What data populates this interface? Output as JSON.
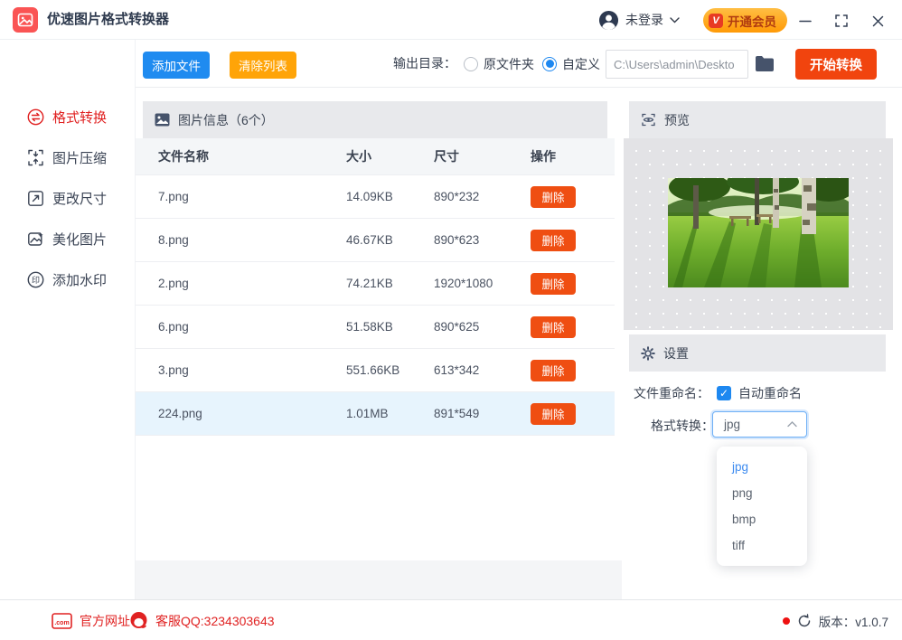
{
  "titlebar": {
    "app_title": "优速图片格式转换器",
    "login_label": "未登录",
    "vip_badge": "V",
    "vip_label": "开通会员"
  },
  "sidebar": {
    "items": [
      {
        "label": "格式转换",
        "icon": "format-convert-icon",
        "active": true
      },
      {
        "label": "图片压缩",
        "icon": "compress-icon",
        "active": false
      },
      {
        "label": "更改尺寸",
        "icon": "resize-icon",
        "active": false
      },
      {
        "label": "美化图片",
        "icon": "beautify-icon",
        "active": false
      },
      {
        "label": "添加水印",
        "icon": "watermark-icon",
        "active": false
      }
    ]
  },
  "toolbar": {
    "add_files": "添加文件",
    "clear_list": "清除列表",
    "output_dir_label": "输出目录：",
    "radio_original": "原文件夹",
    "radio_custom": "自定义",
    "radio_selected": "自定义",
    "path_value": "C:\\Users\\admin\\Deskto",
    "start_button": "开始转换"
  },
  "table": {
    "section_title": "图片信息（6个）",
    "columns": [
      "文件名称",
      "大小",
      "尺寸",
      "操作"
    ],
    "delete_label": "删除",
    "rows": [
      {
        "name": "7.png",
        "size": "14.09KB",
        "dims": "890*232",
        "selected": false
      },
      {
        "name": "8.png",
        "size": "46.67KB",
        "dims": "890*623",
        "selected": false
      },
      {
        "name": "2.png",
        "size": "74.21KB",
        "dims": "1920*1080",
        "selected": false
      },
      {
        "name": "6.png",
        "size": "51.58KB",
        "dims": "890*625",
        "selected": false
      },
      {
        "name": "3.png",
        "size": "551.66KB",
        "dims": "613*342",
        "selected": false
      },
      {
        "name": "224.png",
        "size": "1.01MB",
        "dims": "891*549",
        "selected": true
      }
    ]
  },
  "preview": {
    "title": "预览"
  },
  "settings": {
    "title": "设置",
    "rename_label": "文件重命名：",
    "rename_checkbox_label": "自动重命名",
    "rename_checked": true,
    "check_glyph": "✓",
    "format_label": "格式转换：",
    "format_value": "jpg",
    "options": [
      "jpg",
      "png",
      "bmp",
      "tiff"
    ]
  },
  "footer": {
    "website": "官方网址",
    "qq": "客服QQ:3234303643",
    "version": "版本：v1.0.7"
  },
  "colors": {
    "brand_red": "#fa5454",
    "primary_blue": "#1f8bf0",
    "warning_orange": "#ffa408",
    "action_red": "#f1440e",
    "delete_red": "#ef4e12",
    "active_menu_red": "#e02020",
    "link_red": "#e02222",
    "selected_row_bg": "#e7f4fd",
    "section_header_bg": "#e8e9ec",
    "vip_gradient_top": "#ffbe43",
    "vip_gradient_bottom": "#ff9a06"
  }
}
